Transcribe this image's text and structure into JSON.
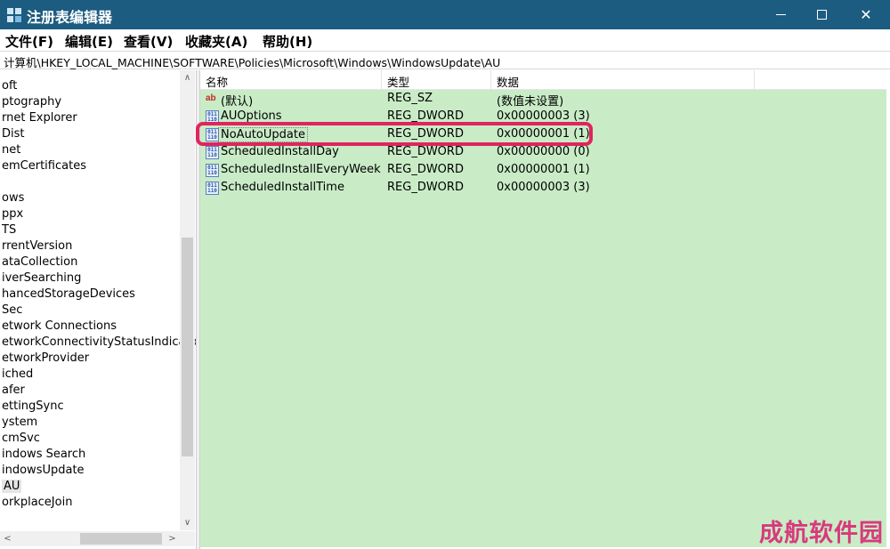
{
  "window": {
    "title": "注册表编辑器"
  },
  "menu": [
    "文件(F)",
    "编辑(E)",
    "查看(V)",
    "收藏夹(A)",
    "帮助(H)"
  ],
  "address": "计算机\\HKEY_LOCAL_MACHINE\\SOFTWARE\\Policies\\Microsoft\\Windows\\WindowsUpdate\\AU",
  "tree": [
    "oft",
    "ptography",
    "rnet Explorer",
    "Dist",
    "net",
    "emCertificates",
    "",
    "ows",
    "ppx",
    "TS",
    "rrentVersion",
    "ataCollection",
    "iverSearching",
    "hancedStorageDevices",
    "Sec",
    "etwork Connections",
    "etworkConnectivityStatusIndicator",
    "etworkProvider",
    "iched",
    "afer",
    "ettingSync",
    "ystem",
    "cmSvc",
    "indows Search",
    "indowsUpdate",
    "AU",
    "orkplaceJoin"
  ],
  "list": {
    "columns": [
      "名称",
      "类型",
      "数据"
    ],
    "rows": [
      {
        "icon": "string-value-icon",
        "name": "(默认)",
        "type": "REG_SZ",
        "data": "(数值未设置)"
      },
      {
        "icon": "dword-value-icon",
        "name": "AUOptions",
        "type": "REG_DWORD",
        "data": "0x00000003 (3)"
      },
      {
        "icon": "dword-value-icon",
        "name": "NoAutoUpdate",
        "type": "REG_DWORD",
        "data": "0x00000001 (1)"
      },
      {
        "icon": "dword-value-icon",
        "name": "ScheduledInstallDay",
        "type": "REG_DWORD",
        "data": "0x00000000 (0)"
      },
      {
        "icon": "dword-value-icon",
        "name": "ScheduledInstallEveryWeek",
        "type": "REG_DWORD",
        "data": "0x00000001 (1)"
      },
      {
        "icon": "dword-value-icon",
        "name": "ScheduledInstallTime",
        "type": "REG_DWORD",
        "data": "0x00000003 (3)"
      }
    ]
  },
  "watermark": "成航软件园",
  "colors": {
    "titlebar": "#1c5c80",
    "list_bg": "#c9ecc7",
    "highlight": "#e0245e"
  }
}
